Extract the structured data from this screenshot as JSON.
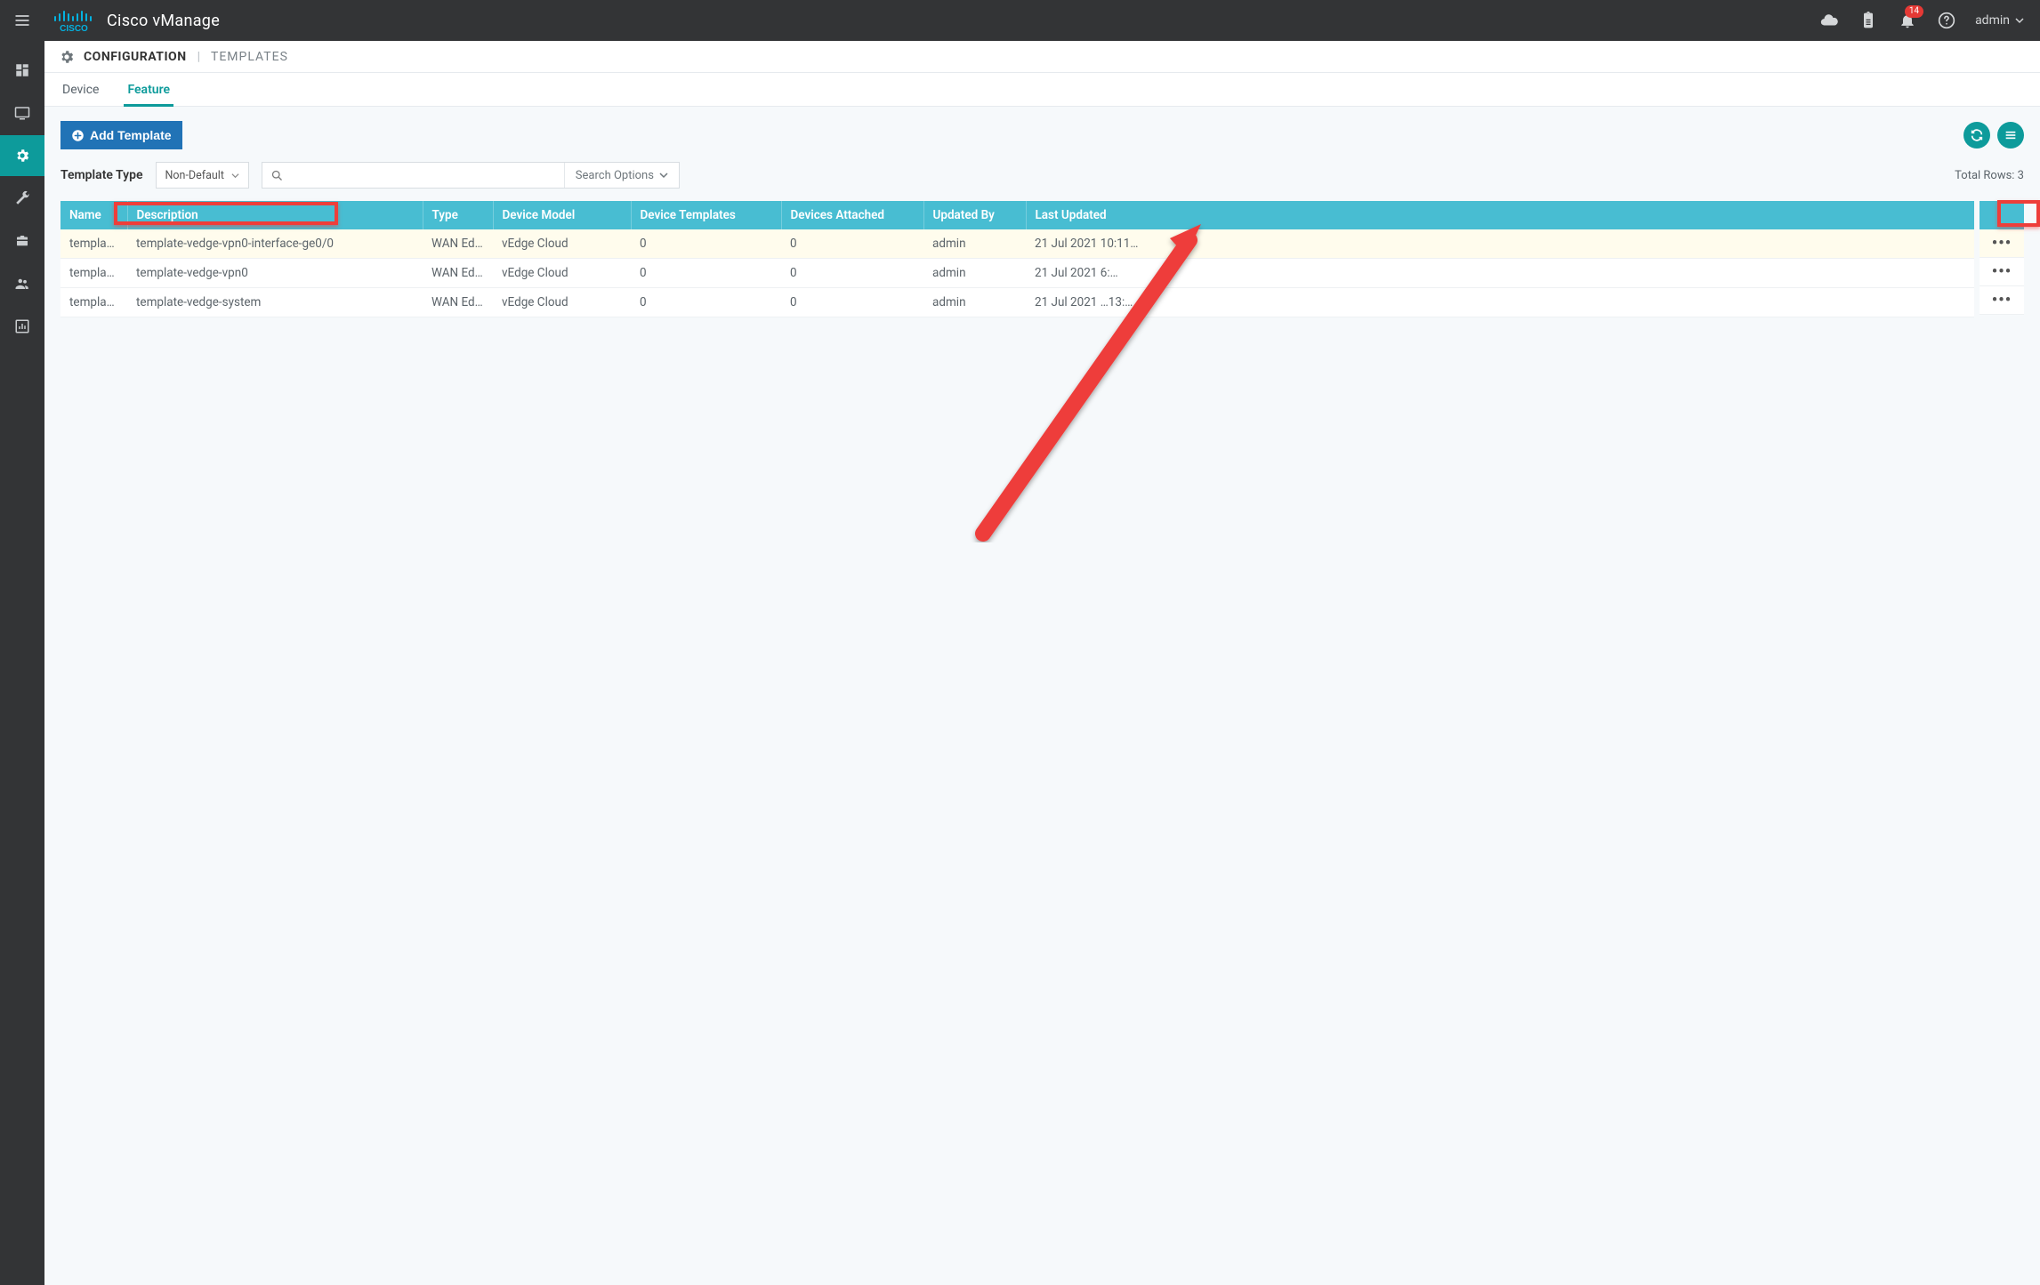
{
  "topbar": {
    "brand_title": "Cisco vManage",
    "notification_count": "14",
    "user_label": "admin"
  },
  "page_header": {
    "title_strong": "CONFIGURATION",
    "title_light": "TEMPLATES"
  },
  "tabs": [
    {
      "label": "Device",
      "active": false
    },
    {
      "label": "Feature",
      "active": true
    }
  ],
  "toolbar": {
    "add_template_label": "Add Template",
    "template_type_label": "Template Type",
    "template_type_value": "Non-Default",
    "search_options_label": "Search Options",
    "total_rows_label": "Total Rows: 3"
  },
  "table": {
    "columns": [
      "Name",
      "Description",
      "Type",
      "Device Model",
      "Device Templates",
      "Devices Attached",
      "Updated By",
      "Last Updated"
    ],
    "rows": [
      {
        "name": "template…",
        "description": "template-vedge-vpn0-interface-ge0/0",
        "type": "WAN Ed…",
        "model": "vEdge Cloud",
        "templates": "0",
        "attached": "0",
        "updated_by": "admin",
        "last_updated": "21 Jul 2021 10:11…",
        "highlight": true
      },
      {
        "name": "template…",
        "description": "template-vedge-vpn0",
        "type": "WAN Ed…",
        "model": "vEdge Cloud",
        "templates": "0",
        "attached": "0",
        "updated_by": "admin",
        "last_updated": "21 Jul 2021 6:…",
        "highlight": false
      },
      {
        "name": "template…",
        "description": "template-vedge-system",
        "type": "WAN Ed…",
        "model": "vEdge Cloud",
        "templates": "0",
        "attached": "0",
        "updated_by": "admin",
        "last_updated": "21 Jul 2021 …13:…",
        "highlight": false
      }
    ]
  }
}
